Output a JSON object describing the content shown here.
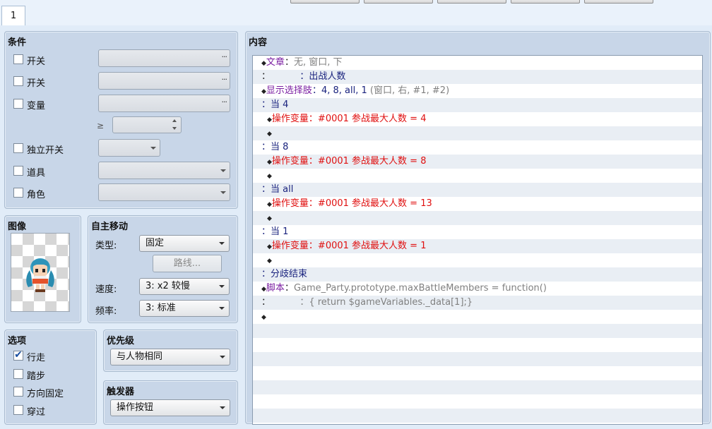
{
  "tabs": [
    {
      "label": "1"
    }
  ],
  "conditions": {
    "title": "条件",
    "switch1": {
      "label": "开关",
      "checked": false,
      "value": "",
      "browse": "..."
    },
    "switch2": {
      "label": "开关",
      "checked": false,
      "value": "",
      "browse": "..."
    },
    "variable": {
      "label": "变量",
      "checked": false,
      "value": "",
      "browse": "..."
    },
    "compare": {
      "symbol": "≥",
      "value": ""
    },
    "self_switch": {
      "label": "独立开关",
      "checked": false,
      "value": ""
    },
    "item": {
      "label": "道具",
      "checked": false,
      "value": ""
    },
    "actor": {
      "label": "角色",
      "checked": false,
      "value": ""
    }
  },
  "image": {
    "title": "图像"
  },
  "autonomous": {
    "title": "自主移动",
    "type_label": "类型:",
    "type_value": "固定",
    "route_label": "路线...",
    "speed_label": "速度:",
    "speed_value": "3: x2 较慢",
    "freq_label": "频率:",
    "freq_value": "3: 标准"
  },
  "options": {
    "title": "选项",
    "walk": {
      "label": "行走",
      "checked": true
    },
    "step": {
      "label": "踏步",
      "checked": false
    },
    "dirfix": {
      "label": "方向固定",
      "checked": false
    },
    "through": {
      "label": "穿过",
      "checked": false
    }
  },
  "priority": {
    "title": "优先级",
    "value": "与人物相同"
  },
  "trigger": {
    "title": "触发器",
    "value": "操作按钮"
  },
  "content": {
    "title": "内容",
    "lines": [
      {
        "parts": [
          {
            "t": "◆",
            "c": "c-dark"
          },
          {
            "t": "文章",
            "c": "c-purple"
          },
          {
            "t": "：",
            "c": "c-dark"
          },
          {
            "t": "无, 窗口, 下",
            "c": "c-gray"
          }
        ],
        "indent": 0
      },
      {
        "parts": [
          {
            "t": "：",
            "c": "c-dark"
          },
          {
            "t": "          ：出战人数",
            "c": "c-navy"
          }
        ],
        "indent": 0
      },
      {
        "parts": [
          {
            "t": "◆",
            "c": "c-dark"
          },
          {
            "t": "显示选择肢",
            "c": "c-purple"
          },
          {
            "t": "：4, 8, all, 1 ",
            "c": "c-navy"
          },
          {
            "t": "(窗口, 右, #1, #2)",
            "c": "c-gray"
          }
        ],
        "indent": 0
      },
      {
        "parts": [
          {
            "t": "：当 4",
            "c": "c-navy"
          }
        ],
        "indent": 0
      },
      {
        "parts": [
          {
            "t": "◆",
            "c": "c-dark"
          },
          {
            "t": "操作变量：#0001 参战最大人数 = 4",
            "c": "c-red"
          }
        ],
        "indent": 1
      },
      {
        "parts": [
          {
            "t": "◆",
            "c": "c-dark"
          }
        ],
        "indent": 1
      },
      {
        "parts": [
          {
            "t": "：当 8",
            "c": "c-navy"
          }
        ],
        "indent": 0
      },
      {
        "parts": [
          {
            "t": "◆",
            "c": "c-dark"
          },
          {
            "t": "操作变量：#0001 参战最大人数 = 8",
            "c": "c-red"
          }
        ],
        "indent": 1
      },
      {
        "parts": [
          {
            "t": "◆",
            "c": "c-dark"
          }
        ],
        "indent": 1
      },
      {
        "parts": [
          {
            "t": "：当 all",
            "c": "c-navy"
          }
        ],
        "indent": 0
      },
      {
        "parts": [
          {
            "t": "◆",
            "c": "c-dark"
          },
          {
            "t": "操作变量：#0001 参战最大人数 = 13",
            "c": "c-red"
          }
        ],
        "indent": 1
      },
      {
        "parts": [
          {
            "t": "◆",
            "c": "c-dark"
          }
        ],
        "indent": 1
      },
      {
        "parts": [
          {
            "t": "：当 1",
            "c": "c-navy"
          }
        ],
        "indent": 0
      },
      {
        "parts": [
          {
            "t": "◆",
            "c": "c-dark"
          },
          {
            "t": "操作变量：#0001 参战最大人数 = 1",
            "c": "c-red"
          }
        ],
        "indent": 1
      },
      {
        "parts": [
          {
            "t": "◆",
            "c": "c-dark"
          }
        ],
        "indent": 1
      },
      {
        "parts": [
          {
            "t": "：分歧结束",
            "c": "c-navy"
          }
        ],
        "indent": 0
      },
      {
        "parts": [
          {
            "t": "◆",
            "c": "c-dark"
          },
          {
            "t": "脚本",
            "c": "c-purple"
          },
          {
            "t": "：",
            "c": "c-dark"
          },
          {
            "t": "Game_Party.prototype.maxBattleMembers = function()",
            "c": "c-gray"
          }
        ],
        "indent": 0
      },
      {
        "parts": [
          {
            "t": "：",
            "c": "c-dark"
          },
          {
            "t": "          ：{ return $gameVariables._data[1];}",
            "c": "c-gray"
          }
        ],
        "indent": 0
      },
      {
        "parts": [
          {
            "t": "◆",
            "c": "c-dark"
          }
        ],
        "indent": 0
      }
    ]
  }
}
